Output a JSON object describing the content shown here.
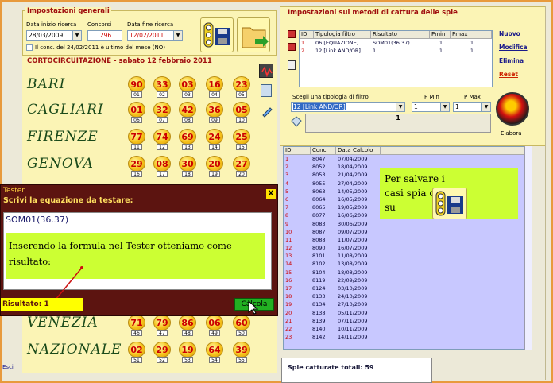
{
  "general": {
    "title": "Impostazioni generali",
    "start_label": "Data inizio ricerca",
    "start_value": "28/03/2009",
    "concorsi_label": "Concorsi",
    "concorsi_value": "296",
    "end_label": "Data fine ricerca",
    "end_value": "12/02/2011",
    "check_label": "Il conc. del 24/02/2011 è ultimo del mese (NO)"
  },
  "draw": {
    "title": "CORTOCIRCUITAZIONE - sabato 12 febbraio 2011",
    "rows": [
      {
        "city": "BARI",
        "nums": [
          "90",
          "33",
          "03",
          "16",
          "23"
        ],
        "pos": [
          "01",
          "02",
          "03",
          "04",
          "05"
        ]
      },
      {
        "city": "CAGLIARI",
        "nums": [
          "01",
          "32",
          "42",
          "36",
          "05"
        ],
        "pos": [
          "06",
          "07",
          "08",
          "09",
          "10"
        ]
      },
      {
        "city": "FIRENZE",
        "nums": [
          "77",
          "74",
          "69",
          "24",
          "25"
        ],
        "pos": [
          "11",
          "12",
          "13",
          "14",
          "15"
        ]
      },
      {
        "city": "GENOVA",
        "nums": [
          "29",
          "08",
          "30",
          "20",
          "27"
        ],
        "pos": [
          "16",
          "17",
          "18",
          "19",
          "20"
        ]
      },
      {
        "city": "VENEZIA",
        "nums": [
          "71",
          "79",
          "86",
          "06",
          "60"
        ],
        "pos": [
          "46",
          "47",
          "48",
          "49",
          "50"
        ]
      },
      {
        "city": "NAZIONALE",
        "nums": [
          "02",
          "29",
          "19",
          "64",
          "39"
        ],
        "pos": [
          "51",
          "52",
          "53",
          "54",
          "55"
        ]
      }
    ]
  },
  "spie": {
    "title": "Impostazioni sui metodi di cattura delle spie",
    "cols": [
      "ID",
      "Tipologia filtro",
      "Risultato",
      "Pmin",
      "Pmax"
    ],
    "rows": [
      {
        "id": "1",
        "tipo": "06 [EQUAZIONE]",
        "ris": "SOM01(36.37)",
        "pmin": "1",
        "pmax": "1"
      },
      {
        "id": "2",
        "tipo": "12 [Link AND/OR]",
        "ris": "1",
        "pmin": "1",
        "pmax": "1"
      }
    ],
    "links": [
      "Nuovo",
      "Modifica",
      "Elimina",
      "Reset"
    ],
    "choose_label": "Scegli una tipologia di filtro",
    "pmin_label": "P Min",
    "pmax_label": "P Max",
    "filter_value": "12 [Link AND/OR]",
    "pmin_value": "1",
    "pmax_value": "1",
    "result_value": "1",
    "elabora": "Elabora"
  },
  "results": {
    "cols": [
      "ID",
      "Conc",
      "Data Calcolo"
    ],
    "rows": [
      [
        "1",
        "8047",
        "07/04/2009"
      ],
      [
        "2",
        "8052",
        "18/04/2009"
      ],
      [
        "3",
        "8053",
        "21/04/2009"
      ],
      [
        "4",
        "8055",
        "27/04/2009"
      ],
      [
        "5",
        "8063",
        "14/05/2009"
      ],
      [
        "6",
        "8064",
        "16/05/2009"
      ],
      [
        "7",
        "8065",
        "19/05/2009"
      ],
      [
        "8",
        "8077",
        "16/06/2009"
      ],
      [
        "9",
        "8083",
        "30/06/2009"
      ],
      [
        "10",
        "8087",
        "09/07/2009"
      ],
      [
        "11",
        "8088",
        "11/07/2009"
      ],
      [
        "12",
        "8090",
        "16/07/2009"
      ],
      [
        "13",
        "8101",
        "11/08/2009"
      ],
      [
        "14",
        "8102",
        "13/08/2009"
      ],
      [
        "15",
        "8104",
        "18/08/2009"
      ],
      [
        "16",
        "8119",
        "22/09/2009"
      ],
      [
        "17",
        "8124",
        "03/10/2009"
      ],
      [
        "18",
        "8133",
        "24/10/2009"
      ],
      [
        "19",
        "8134",
        "27/10/2009"
      ],
      [
        "20",
        "8138",
        "05/11/2009"
      ],
      [
        "21",
        "8139",
        "07/11/2009"
      ],
      [
        "22",
        "8140",
        "10/11/2009"
      ],
      [
        "23",
        "8142",
        "14/11/2009"
      ]
    ],
    "note": "Per salvare  i casi spia click su"
  },
  "status": {
    "text": "Spie catturate totali: 59"
  },
  "tester": {
    "title": "Tester",
    "close": "X",
    "prompt": "Scrivi la equazione da testare:",
    "equation": "SOM01(36.37)",
    "note": "Inserendo la formula nel Tester otteniamo come risultato:",
    "result_label": "Risultato:",
    "result_value": "1",
    "calc_button": "Calcola"
  },
  "footer": {
    "left_text": "Esci"
  }
}
